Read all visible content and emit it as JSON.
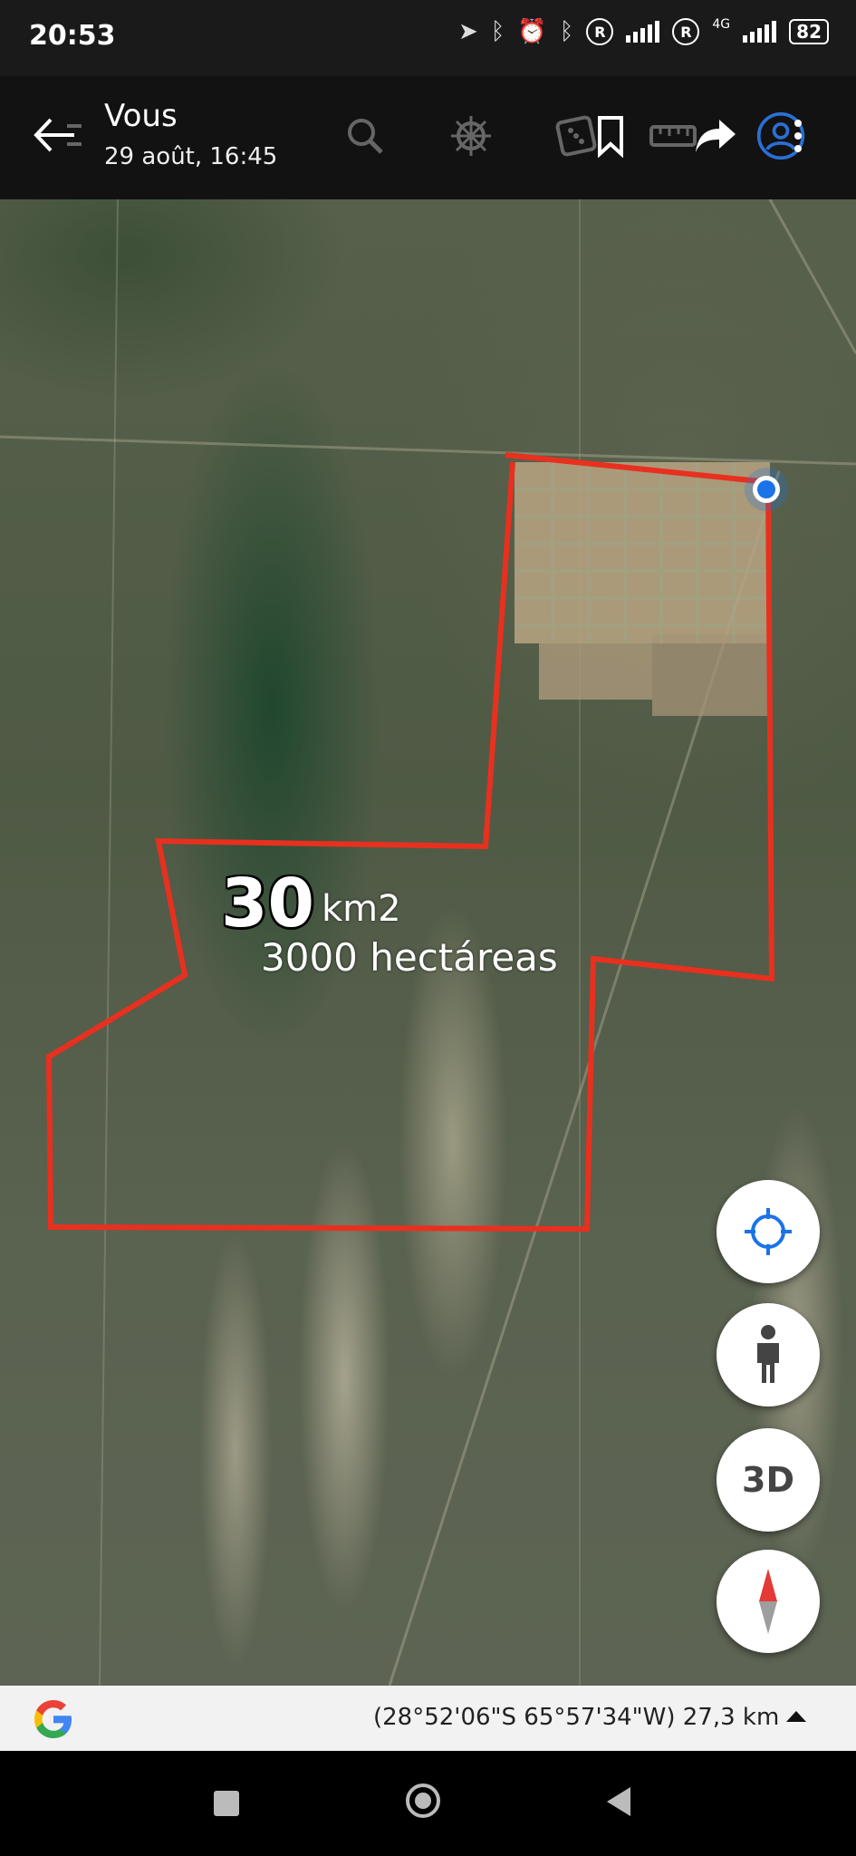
{
  "status_bar": {
    "time": "20:53",
    "network_type": "4G",
    "battery": "82"
  },
  "toolbar": {
    "title": "Vous",
    "subtitle": "29 août, 16:45",
    "icons": [
      "back-arrow-icon",
      "search-icon",
      "ship-wheel-icon",
      "dice-icon",
      "bookmark-icon",
      "ruler-icon",
      "share-icon",
      "account-icon",
      "more-icon"
    ]
  },
  "map": {
    "area_value": "30",
    "area_unit": "km2",
    "area_hectares": "3000 hectáreas",
    "polygon_color": "#e8301f",
    "location_dot_color": "#1a73e8"
  },
  "controls": {
    "three_d_label": "3D",
    "icons": [
      "my-location-icon",
      "street-view-icon",
      "compass-icon"
    ]
  },
  "bottom_bar": {
    "coordinates": "(28°52'06\"S 65°57'34\"W) 27,3 km"
  },
  "nav_bar": {
    "icons": [
      "recents-icon",
      "home-icon",
      "back-icon"
    ]
  }
}
